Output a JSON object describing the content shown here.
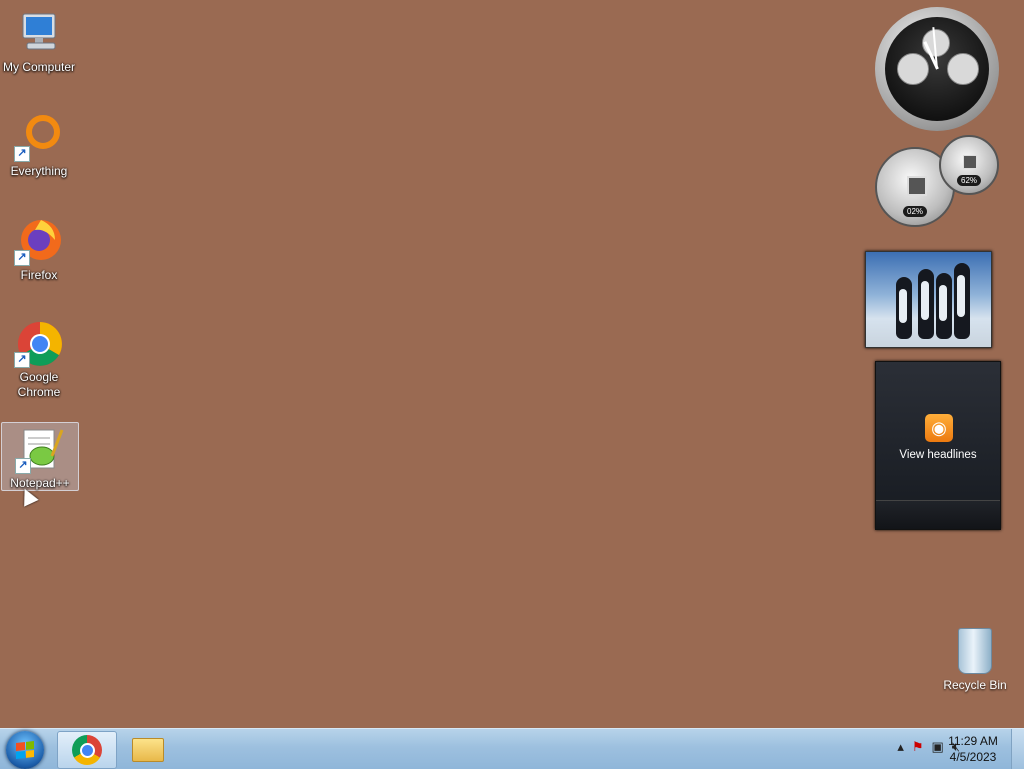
{
  "desktop": {
    "background_color": "#9a6a52",
    "icons": [
      {
        "label": "My Computer",
        "icon": "computer-icon",
        "shortcut": false
      },
      {
        "label": "Everything",
        "icon": "everything-icon",
        "shortcut": true
      },
      {
        "label": "Firefox",
        "icon": "firefox-icon",
        "shortcut": true
      },
      {
        "label": "Google Chrome",
        "icon": "chrome-icon",
        "shortcut": true
      },
      {
        "label": "Notepad++",
        "icon": "notepadpp-icon",
        "shortcut": true,
        "selected": true
      }
    ],
    "recycle_bin": {
      "label": "Recycle Bin",
      "icon": "recycle-bin-icon"
    }
  },
  "gadgets": {
    "meters": {
      "cpu_percent": "02%",
      "memory_percent": "62%"
    },
    "feed": {
      "label": "View headlines",
      "icon": "rss-icon"
    }
  },
  "taskbar": {
    "start_icon": "windows-start-icon",
    "pinned": [
      {
        "name": "Google Chrome",
        "icon": "chrome-icon",
        "active": true
      },
      {
        "name": "Windows Explorer",
        "icon": "folder-icon",
        "active": false
      }
    ],
    "tray_icons": [
      "show-hidden-icons-arrow-icon",
      "action-center-flag-icon",
      "network-icon",
      "volume-muted-icon"
    ],
    "time": "11:29 AM",
    "date": "4/5/2023"
  }
}
